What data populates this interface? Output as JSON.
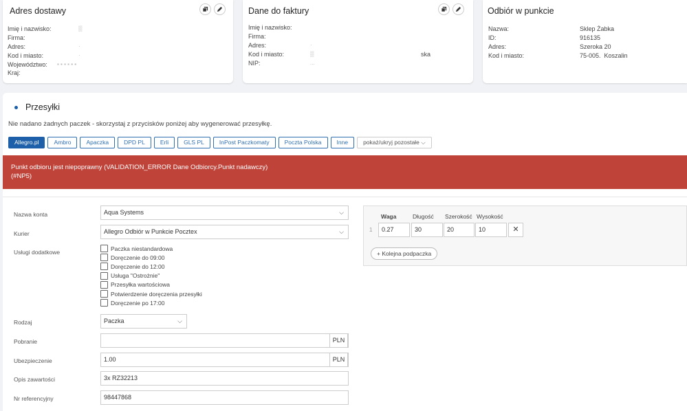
{
  "delivery_address": {
    "title": "Adres dostawy",
    "labels": [
      "Imię i nazwisko:",
      "Firma:",
      "Adres:",
      "Kod i miasto:",
      "Województwo:",
      "Kraj:"
    ]
  },
  "invoice": {
    "title": "Dane do faktury",
    "labels": [
      "Imię i nazwisko:",
      "Firma:",
      "Adres:",
      "Kod i miasto:",
      "NIP:"
    ],
    "country_partial": "ska"
  },
  "pickup_point": {
    "title": "Odbiór w punkcie",
    "rows": [
      {
        "label": "Nazwa:",
        "value": "Sklep Żabka"
      },
      {
        "label": "ID:",
        "value": "916135"
      },
      {
        "label": "Adres:",
        "value": "Szeroka 20"
      },
      {
        "label": "Kod i miasto:",
        "value": "75-005.  Koszalin"
      }
    ]
  },
  "shipments": {
    "title": "Przesyłki",
    "info": "Nie nadano żadnych paczek - skorzystaj z przycisków poniżej aby wygenerować przesyłkę.",
    "couriers": [
      "Allegro.pl",
      "Ambro",
      "Apaczka",
      "DPD PL",
      "Erli",
      "GLS PL",
      "InPost Paczkomaty",
      "Poczta Polska",
      "Inne"
    ],
    "more_toggle": "pokaż/ukryj pozostałe"
  },
  "error": {
    "line1": "Punkt odbioru jest niepoprawny (VALIDATION_ERROR Dane Odbiorcy.Punkt nadawczy)",
    "line2": "(#NP5)"
  },
  "form": {
    "account_label": "Nazwa konta",
    "account_value": "Aqua Systems",
    "courier_label": "Kurier",
    "courier_value": "Allegro Odbiór w Punkcie Pocztex",
    "services_label": "Usługi dodatkowe",
    "services": [
      "Paczka niestandardowa",
      "Doręczenie do 09:00",
      "Doręczenie do 12:00",
      "Usługa \"Ostrożnie\"",
      "Przesyłka wartościowa",
      "Potwierdzenie doręczenia przesyłki",
      "Doręczenie po 17:00"
    ],
    "type_label": "Rodzaj",
    "type_value": "Paczka",
    "cod_label": "Pobranie",
    "cod_value": "",
    "insurance_label": "Ubezpieczenie",
    "insurance_value": "1.00",
    "currency": "PLN",
    "content_label": "Opis zawartości",
    "content_value": "3x RZ32213",
    "ref_label": "Nr referencyjny",
    "ref_value": "98447868"
  },
  "parcel": {
    "headers": [
      "Waga",
      "Długość",
      "Szerokość",
      "Wysokość"
    ],
    "index": "1",
    "weight": "0.27",
    "length": "30",
    "width": "20",
    "height": "10",
    "add_label": "Kolejna podpaczka"
  }
}
